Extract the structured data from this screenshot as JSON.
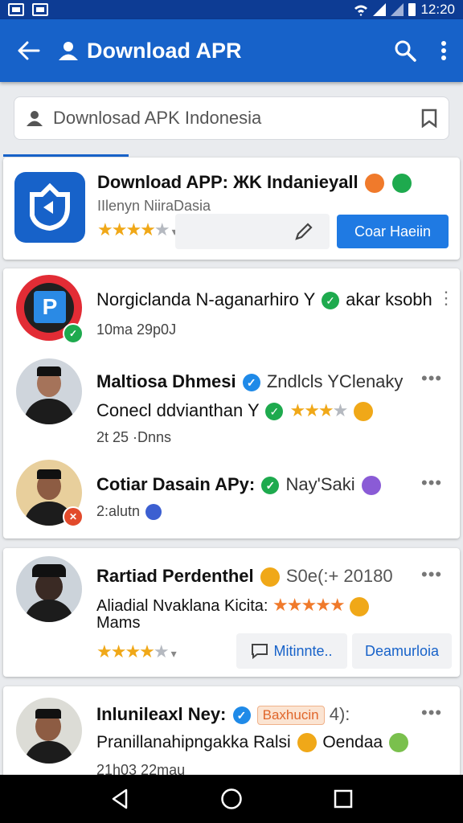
{
  "status": {
    "time": "12:20"
  },
  "appbar": {
    "title": "Download APR"
  },
  "search": {
    "placeholder": "Downlosad APK Indonesia"
  },
  "app_card": {
    "title": "Download APP: ЖK Indanieyall",
    "subtitle": "IIlenyn NiiraDasia",
    "rating": 3.5,
    "action_label": "Coar Haeiin"
  },
  "list_card": {
    "items": [
      {
        "name": "Norgiclanda N-aganarhiro Y",
        "name_tail": "akar ksobh",
        "meta": "10ma 29p0J"
      },
      {
        "name": "Maltiosa Dhmesi",
        "name_tail": "Zndlcls YClenaky",
        "line2": "Conecl ddvianthan Y",
        "meta": "2t 25 ·Dnns",
        "rating": 3.5
      },
      {
        "name": "Cotiar Dasain APy:",
        "name_tail": "Nay'Saki",
        "meta": "2:alutn"
      }
    ]
  },
  "post_card": {
    "name": "Rartiad Perdenthel",
    "name_tail": "S0e(:+ 20180",
    "line2": "Aliadial Nvaklana Kicita:",
    "line3": "Mams",
    "rating": 3.5,
    "btn_secondary": "Mitinnte..",
    "btn_tertiary": "Deamurloia"
  },
  "last_card": {
    "name": "Inlunileaxl Ney:",
    "badge": "Baxhucin",
    "badge_tail": "4):",
    "line2": "Pranillanahipngakka Ralsi",
    "line2_tail": "Oendaa",
    "meta": "21h03 22mau"
  },
  "colors": {
    "appbar": "#1762c9",
    "statusbar": "#0d3c94",
    "accent": "#1f7ae3",
    "star": "#f0a818"
  }
}
